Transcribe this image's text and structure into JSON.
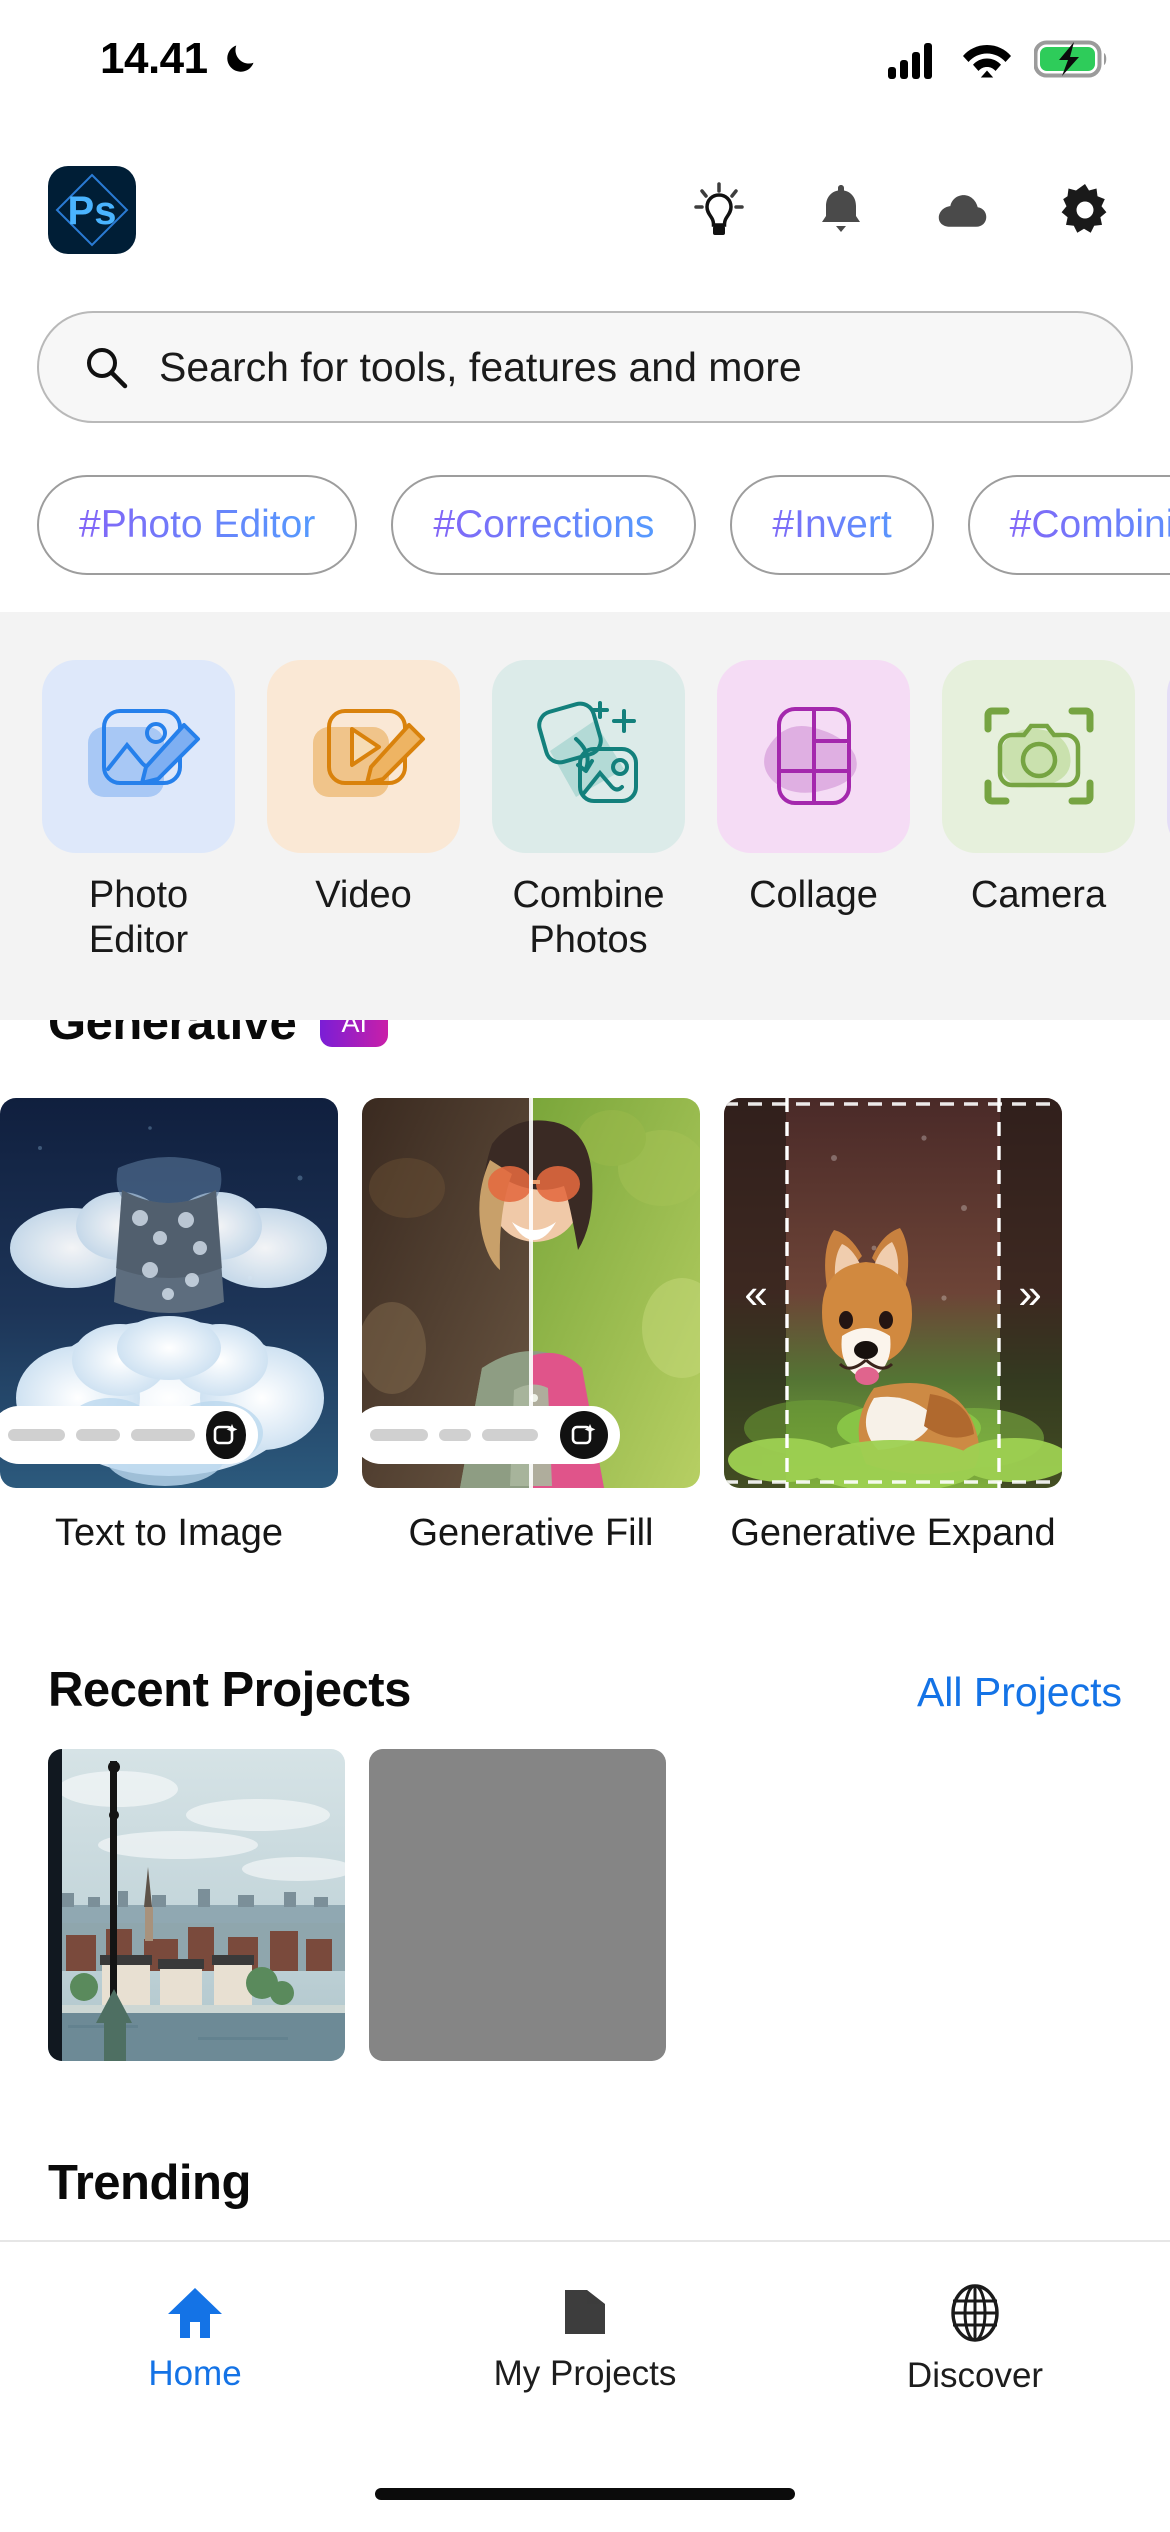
{
  "status_bar": {
    "time": "14.41",
    "icons": [
      "moon-icon",
      "cellular-signal-icon",
      "wifi-icon",
      "battery-charging-icon"
    ],
    "battery_color": "#2ecc5a"
  },
  "app_bar": {
    "logo_label": "Ps",
    "logo_bg": "#001e36",
    "logo_accent": "#4ab4ff",
    "icons": [
      "lightbulb-icon",
      "bell-icon",
      "cloud-icon",
      "gear-icon"
    ]
  },
  "search": {
    "placeholder": "Search for tools, features and more",
    "icon": "search-icon"
  },
  "tags": [
    {
      "label": "#Photo Editor"
    },
    {
      "label": "#Corrections"
    },
    {
      "label": "#Invert"
    },
    {
      "label": "#Combining"
    }
  ],
  "tools": [
    {
      "label": "Photo Editor",
      "icon": "photo-edit-icon",
      "tile_bg": "#dee8fa",
      "accent": "#2680eb",
      "accent_soft": "#a8c8f5"
    },
    {
      "label": "Video",
      "icon": "video-edit-icon",
      "tile_bg": "#fae8d5",
      "accent": "#d9820c",
      "accent_soft": "#f0c48a"
    },
    {
      "label": "Combine Photos",
      "icon": "combine-photos-icon",
      "tile_bg": "#dcebe9",
      "accent": "#13807c",
      "accent_soft": "#a9d6d1"
    },
    {
      "label": "Collage",
      "icon": "collage-grid-icon",
      "tile_bg": "#f5dcf5",
      "accent": "#a428ad",
      "accent_soft": "#deaee0"
    },
    {
      "label": "Camera",
      "icon": "camera-icon",
      "tile_bg": "#e6f0dc",
      "accent": "#76a442",
      "accent_soft": "#c6dfa8"
    },
    {
      "label": "",
      "icon": "partial-card",
      "tile_bg": "#e4ddf7",
      "accent": "#6b4fd8",
      "accent_soft": "#c2b4f0"
    }
  ],
  "generative": {
    "title": "Generative",
    "badge": "AI",
    "badge_gradient": [
      "#7a1ed6",
      "#c91fa8"
    ],
    "cards": [
      {
        "label": "Text to Image",
        "thumb": "cloud-dress-image",
        "has_prompt_bar": true
      },
      {
        "label": "Generative Fill",
        "thumb": "woman-sunglasses-split-image",
        "has_prompt_bar": true
      },
      {
        "label": "Generative Expand",
        "thumb": "corgi-dog-image",
        "has_prompt_bar": false,
        "chevrons": [
          "«",
          "»"
        ]
      }
    ]
  },
  "recent_projects": {
    "title": "Recent Projects",
    "link": "All Projects",
    "link_color": "#1473e6",
    "items": [
      {
        "thumb": "stockholm-cityscape-photo"
      },
      {
        "thumb": "gray-placeholder",
        "color": "#858585"
      }
    ]
  },
  "trending": {
    "title": "Trending"
  },
  "bottom_nav": {
    "active_color": "#1473e6",
    "items": [
      {
        "label": "Home",
        "icon": "home-icon",
        "active": true
      },
      {
        "label": "My Projects",
        "icon": "folder-icon",
        "active": false
      },
      {
        "label": "Discover",
        "icon": "globe-icon",
        "active": false
      }
    ]
  }
}
